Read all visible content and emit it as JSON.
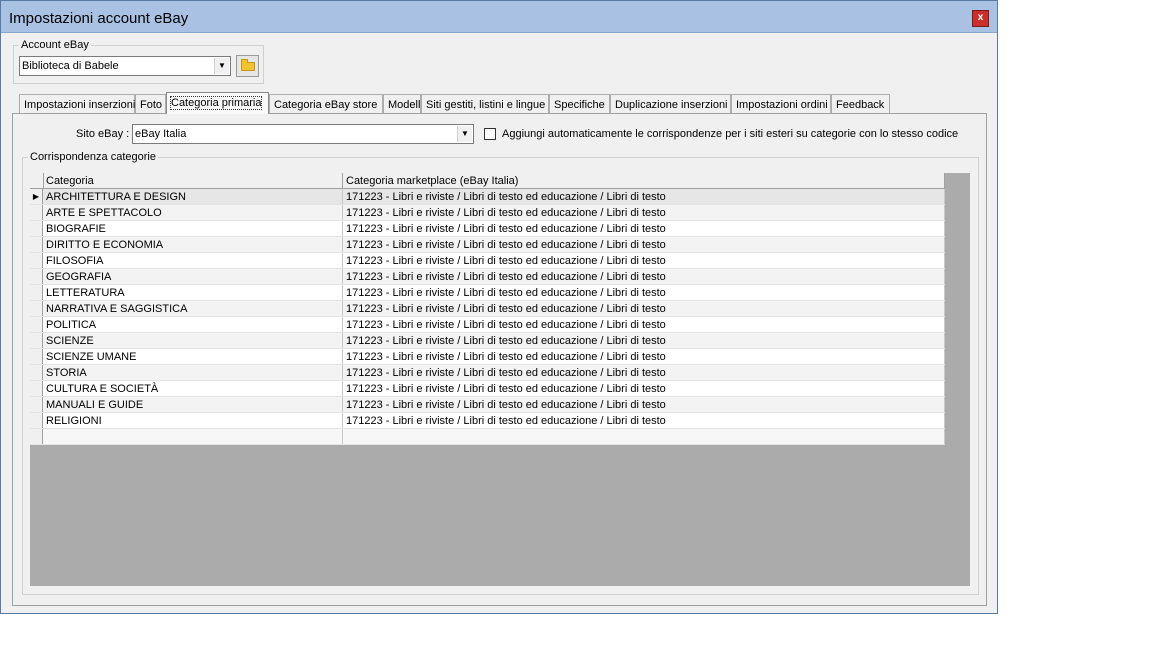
{
  "window": {
    "title": "Impostazioni account eBay",
    "close_label": "x"
  },
  "account": {
    "group_label": "Account eBay",
    "selected": "Biblioteca di Babele"
  },
  "tabs": [
    {
      "label": "Impostazioni inserzioni",
      "active": false
    },
    {
      "label": "Foto",
      "active": false
    },
    {
      "label": "Categoria primaria",
      "active": true
    },
    {
      "label": "Categoria eBay store",
      "active": false
    },
    {
      "label": "Modelli",
      "active": false
    },
    {
      "label": "Siti gestiti, listini e lingue",
      "active": false
    },
    {
      "label": "Specifiche",
      "active": false
    },
    {
      "label": "Duplicazione inserzioni",
      "active": false
    },
    {
      "label": "Impostazioni ordini",
      "active": false
    },
    {
      "label": "Feedback",
      "active": false
    }
  ],
  "site": {
    "label": "Sito eBay :",
    "selected": "eBay Italia",
    "auto_checkbox_label": "Aggiungi automaticamente le corrispondenze per i siti esteri su categorie con lo stesso codice",
    "auto_checked": false
  },
  "mapping": {
    "group_label": "Corrispondenza categorie",
    "columns": [
      "Categoria",
      "Categoria marketplace (eBay Italia)"
    ],
    "rows": [
      [
        "ARCHITETTURA E DESIGN",
        "171223 - Libri e riviste / Libri di testo ed educazione / Libri di testo"
      ],
      [
        "ARTE E SPETTACOLO",
        "171223 - Libri e riviste / Libri di testo ed educazione / Libri di testo"
      ],
      [
        "BIOGRAFIE",
        "171223 - Libri e riviste / Libri di testo ed educazione / Libri di testo"
      ],
      [
        "DIRITTO E ECONOMIA",
        "171223 - Libri e riviste / Libri di testo ed educazione / Libri di testo"
      ],
      [
        "FILOSOFIA",
        "171223 - Libri e riviste / Libri di testo ed educazione / Libri di testo"
      ],
      [
        "GEOGRAFIA",
        "171223 - Libri e riviste / Libri di testo ed educazione / Libri di testo"
      ],
      [
        "LETTERATURA",
        "171223 - Libri e riviste / Libri di testo ed educazione / Libri di testo"
      ],
      [
        "NARRATIVA E SAGGISTICA",
        "171223 - Libri e riviste / Libri di testo ed educazione / Libri di testo"
      ],
      [
        "POLITICA",
        "171223 - Libri e riviste / Libri di testo ed educazione / Libri di testo"
      ],
      [
        "SCIENZE",
        "171223 - Libri e riviste / Libri di testo ed educazione / Libri di testo"
      ],
      [
        "SCIENZE UMANE",
        "171223 - Libri e riviste / Libri di testo ed educazione / Libri di testo"
      ],
      [
        "STORIA",
        "171223 - Libri e riviste / Libri di testo ed educazione / Libri di testo"
      ],
      [
        "CULTURA E SOCIETÀ",
        "171223 - Libri e riviste / Libri di testo ed educazione / Libri di testo"
      ],
      [
        "MANUALI E GUIDE",
        "171223 - Libri e riviste / Libri di testo ed educazione / Libri di testo"
      ],
      [
        "RELIGIONI",
        "171223 - Libri e riviste / Libri di testo ed educazione / Libri di testo"
      ]
    ]
  },
  "colors": {
    "titlebar": "#a9c1e2",
    "grid_background": "#ababab",
    "close_button": "#c9302c"
  },
  "icons": {
    "close": "close-icon",
    "dropdown": "chevron-down-icon",
    "folder": "folder-icon",
    "row_pointer": "row-pointer-icon"
  }
}
